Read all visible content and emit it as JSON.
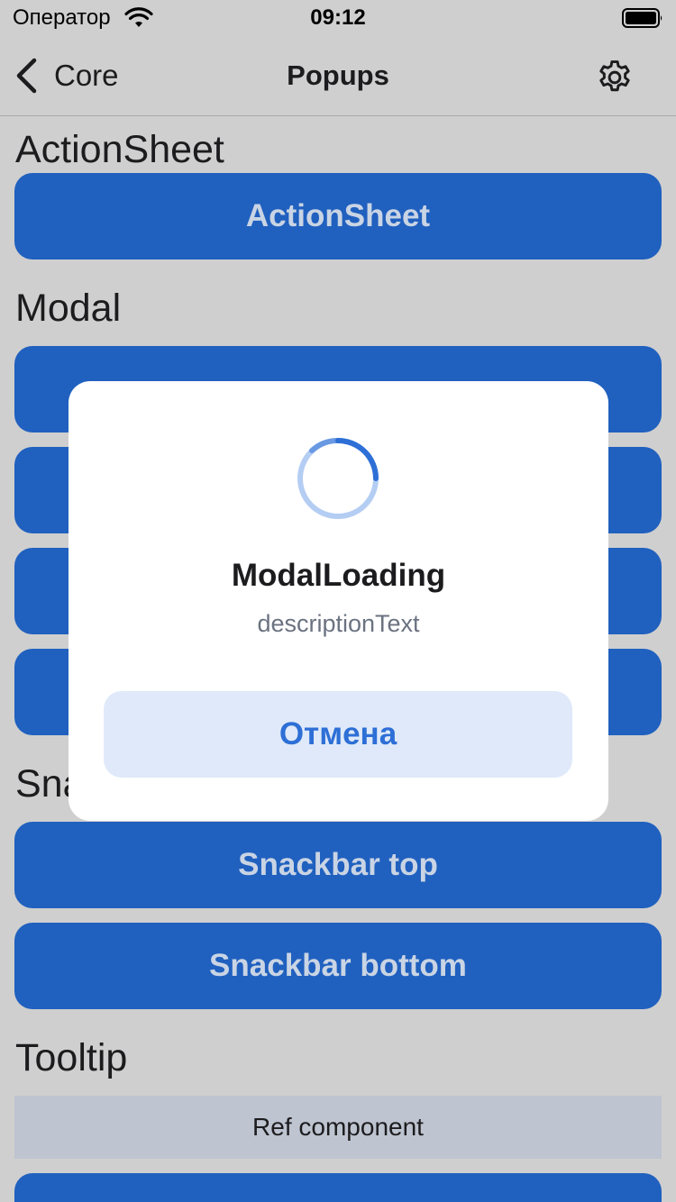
{
  "status_bar": {
    "carrier": "Оператор",
    "time": "09:12"
  },
  "nav": {
    "back_label": "Core",
    "title": "Popups"
  },
  "sections": {
    "action_sheet": {
      "title": "ActionSheet",
      "button": "ActionSheet"
    },
    "modal": {
      "title": "Modal"
    },
    "snackbar": {
      "title": "Sna",
      "top_button": "Snackbar top",
      "bottom_button": "Snackbar bottom"
    },
    "tooltip": {
      "title": "Tooltip",
      "ref_component": "Ref component"
    }
  },
  "modal_dialog": {
    "title": "ModalLoading",
    "description": "descriptionText",
    "cancel_label": "Отмена"
  },
  "colors": {
    "overlay_bg": "#cfcfcf",
    "button_bg": "#2060bf",
    "button_text": "#c9d4e4",
    "cancel_bg": "#dfe9f9",
    "cancel_text": "#2d6fd6",
    "spinner": "#2d6fd6"
  }
}
